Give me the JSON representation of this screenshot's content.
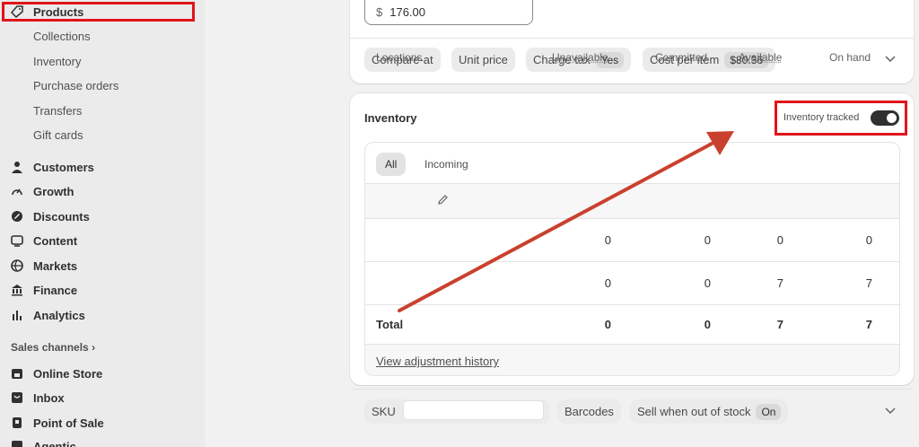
{
  "sidebar": {
    "products": "Products",
    "sub_items": [
      "Collections",
      "Inventory",
      "Purchase orders",
      "Transfers",
      "Gift cards"
    ],
    "main_items": [
      "Customers",
      "Growth",
      "Discounts",
      "Content",
      "Markets",
      "Finance",
      "Analytics"
    ],
    "sales_channels_label": "Sales channels",
    "channels": [
      "Online Store",
      "Inbox",
      "Point of Sale",
      "Agentic"
    ]
  },
  "pricing": {
    "currency": "$",
    "price": "176.00",
    "compare_at": "Compare-at",
    "unit_price": "Unit price",
    "charge_tax": "Charge tax",
    "charge_tax_value": "Yes",
    "cost_per_item": "Cost per item",
    "cost_per_item_value": "$80.36"
  },
  "inventory": {
    "title": "Inventory",
    "tracked_label": "Inventory tracked",
    "tracked": true,
    "tabs": [
      "All",
      "Incoming"
    ],
    "columns": [
      "Locations",
      "Unavailable",
      "Committed",
      "Available",
      "On hand"
    ],
    "rows": [
      {
        "unavailable": "0",
        "committed": "0",
        "available": "0",
        "on_hand": "0"
      },
      {
        "unavailable": "0",
        "committed": "0",
        "available": "7",
        "on_hand": "7"
      }
    ],
    "total": {
      "label": "Total",
      "unavailable": "0",
      "committed": "0",
      "available": "7",
      "on_hand": "7"
    },
    "history_link": "View adjustment history"
  },
  "bottom": {
    "sku": "SKU",
    "barcodes": "Barcodes",
    "sell_oos": "Sell when out of stock",
    "sell_oos_value": "On"
  },
  "colors": {
    "highlight": "#e0151b",
    "arrow": "#c9412e"
  }
}
